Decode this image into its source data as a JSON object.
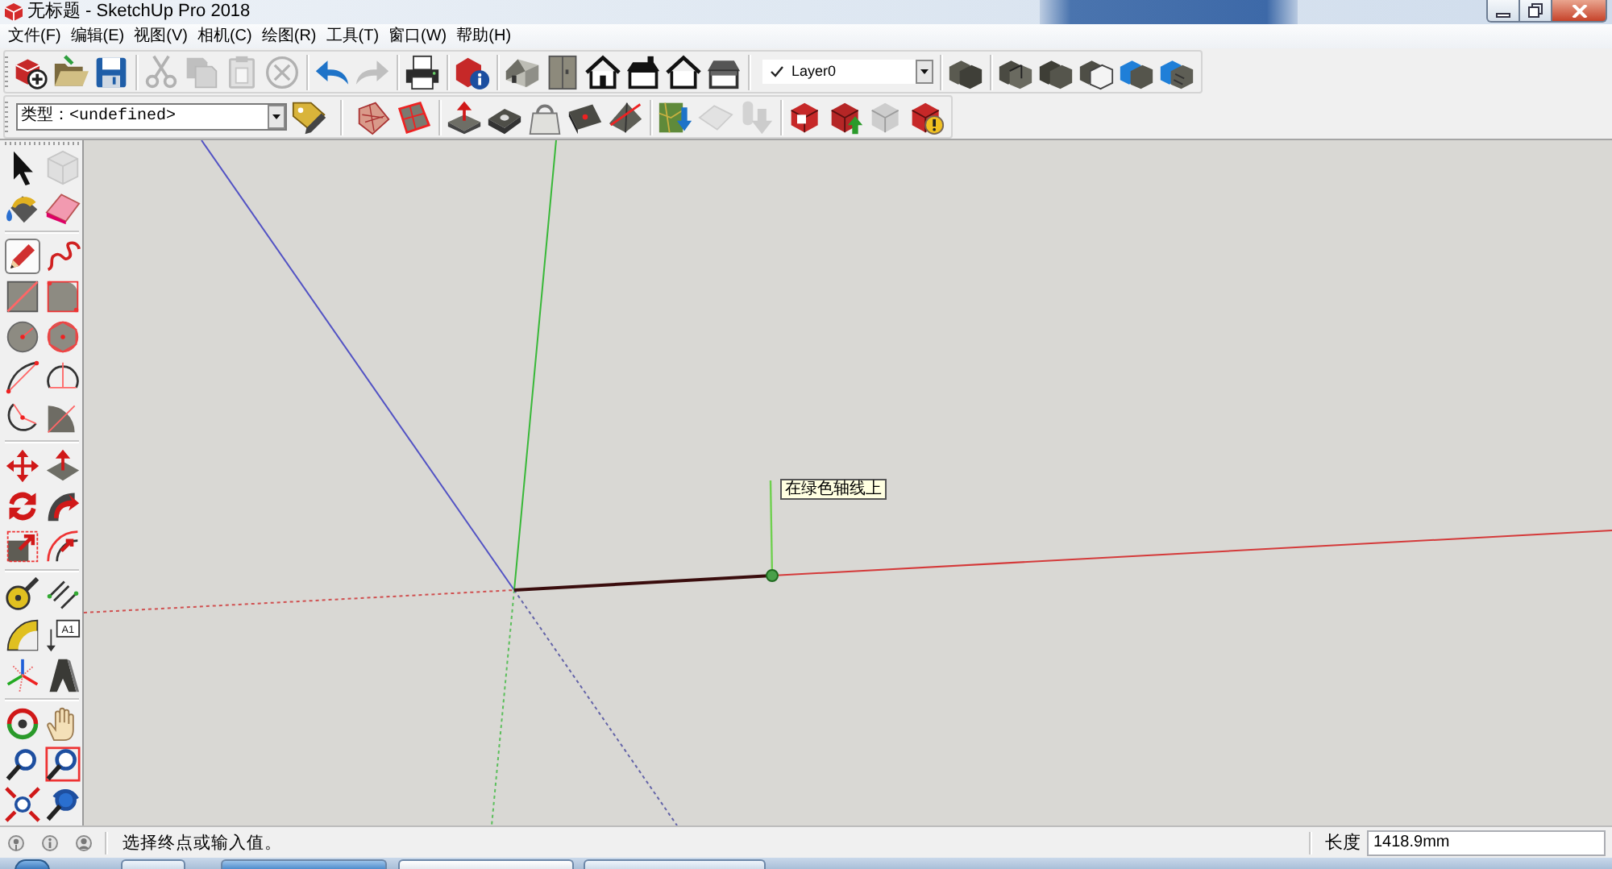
{
  "window": {
    "title": "无标题 - SketchUp Pro 2018"
  },
  "menu_bar": [
    "文件(F)",
    "编辑(E)",
    "视图(V)",
    "相机(C)",
    "绘图(R)",
    "工具(T)",
    "窗口(W)",
    "帮助(H)"
  ],
  "toolbar_row_1": [
    {
      "kind": "buttons",
      "items": [
        {
          "kind": "new",
          "disabled": false
        },
        {
          "kind": "open",
          "disabled": false
        },
        {
          "kind": "save",
          "disabled": false
        }
      ]
    },
    {
      "kind": "buttons",
      "items": [
        {
          "kind": "cut",
          "disabled": true
        },
        {
          "kind": "copy",
          "disabled": true
        },
        {
          "kind": "paste",
          "disabled": true
        },
        {
          "kind": "erase",
          "disabled": true
        }
      ]
    },
    {
      "kind": "buttons",
      "items": [
        {
          "kind": "undo",
          "disabled": false
        },
        {
          "kind": "redo",
          "disabled": true
        }
      ]
    },
    {
      "kind": "buttons",
      "items": [
        {
          "kind": "print",
          "disabled": false
        }
      ]
    },
    {
      "kind": "buttons",
      "items": [
        {
          "kind": "info",
          "disabled": false
        }
      ]
    },
    {
      "kind": "buttons",
      "items": [
        {
          "kind": "iso",
          "disabled": false
        },
        {
          "kind": "top",
          "disabled": false
        },
        {
          "kind": "front",
          "disabled": false
        },
        {
          "kind": "right",
          "disabled": false
        },
        {
          "kind": "back",
          "disabled": false
        },
        {
          "kind": "left",
          "disabled": false
        }
      ]
    },
    {
      "kind": "layer",
      "value": "Layer0"
    },
    {
      "kind": "buttons",
      "items": [
        {
          "kind": "xray",
          "disabled": false
        }
      ]
    },
    {
      "kind": "buttons",
      "items": [
        {
          "kind": "backedges",
          "disabled": false
        },
        {
          "kind": "wireframe",
          "disabled": false
        },
        {
          "kind": "hidden",
          "disabled": false
        },
        {
          "kind": "shaded",
          "disabled": false
        },
        {
          "kind": "textured",
          "disabled": false
        }
      ]
    }
  ],
  "toolbar_row_2": [
    {
      "kind": "type",
      "value": "类型：<undefined>",
      "items": [
        {
          "kind": "tagpen",
          "disabled": false
        }
      ]
    },
    {
      "kind": "buttons",
      "items": [
        {
          "kind": "tiles",
          "disabled": false
        },
        {
          "kind": "redgrid",
          "disabled": false
        }
      ]
    },
    {
      "kind": "buttons",
      "items": [
        {
          "kind": "boxarrow",
          "disabled": false
        },
        {
          "kind": "boxhole",
          "disabled": false
        },
        {
          "kind": "bag",
          "disabled": false
        },
        {
          "kind": "plate",
          "disabled": false
        },
        {
          "kind": "pyramid",
          "disabled": false
        }
      ]
    },
    {
      "kind": "buttons",
      "items": [
        {
          "kind": "map",
          "disabled": false
        },
        {
          "kind": "rhombus",
          "disabled": true
        },
        {
          "kind": "downarrow",
          "disabled": true
        }
      ]
    },
    {
      "kind": "buttons",
      "items": [
        {
          "kind": "redcube",
          "disabled": false
        },
        {
          "kind": "cubeup",
          "disabled": false
        },
        {
          "kind": "greycube",
          "disabled": true
        },
        {
          "kind": "cubewarn",
          "disabled": false
        }
      ]
    }
  ],
  "tool_palette": [
    {
      "items": [
        {
          "kind": "select",
          "selected": false,
          "disabled": false
        },
        {
          "kind": "component",
          "selected": false,
          "disabled": true
        },
        {
          "kind": "paint",
          "selected": false,
          "disabled": false
        },
        {
          "kind": "eraser",
          "selected": false,
          "disabled": false
        }
      ]
    },
    {
      "items": [
        {
          "kind": "pencil",
          "selected": true,
          "disabled": false
        },
        {
          "kind": "freehand",
          "selected": false,
          "disabled": false
        },
        {
          "kind": "rectangle",
          "selected": false,
          "disabled": false
        },
        {
          "kind": "rotrect",
          "selected": false,
          "disabled": false
        },
        {
          "kind": "circle",
          "selected": false,
          "disabled": false
        },
        {
          "kind": "polygon",
          "selected": false,
          "disabled": false
        },
        {
          "kind": "arc",
          "selected": false,
          "disabled": false
        },
        {
          "kind": "arc2",
          "selected": false,
          "disabled": false
        },
        {
          "kind": "arc3",
          "selected": false,
          "disabled": false
        },
        {
          "kind": "pie",
          "selected": false,
          "disabled": false
        }
      ]
    },
    {
      "items": [
        {
          "kind": "move",
          "selected": false,
          "disabled": false
        },
        {
          "kind": "pushpull",
          "selected": false,
          "disabled": false
        },
        {
          "kind": "rotate",
          "selected": false,
          "disabled": false
        },
        {
          "kind": "followme",
          "selected": false,
          "disabled": false
        },
        {
          "kind": "scale",
          "selected": false,
          "disabled": false
        },
        {
          "kind": "offset",
          "selected": false,
          "disabled": false
        }
      ]
    },
    {
      "items": [
        {
          "kind": "tape",
          "selected": false,
          "disabled": false
        },
        {
          "kind": "dimension",
          "selected": false,
          "disabled": false
        },
        {
          "kind": "protractor",
          "selected": false,
          "disabled": false
        },
        {
          "kind": "text",
          "selected": false,
          "disabled": false,
          "label": "A1"
        },
        {
          "kind": "axes",
          "selected": false,
          "disabled": false
        },
        {
          "kind": "text3d",
          "selected": false,
          "disabled": false
        }
      ]
    },
    {
      "items": [
        {
          "kind": "orbit",
          "selected": false,
          "disabled": false
        },
        {
          "kind": "pan",
          "selected": false,
          "disabled": false
        },
        {
          "kind": "zoom",
          "selected": false,
          "disabled": false
        },
        {
          "kind": "zoomwin",
          "selected": false,
          "disabled": false
        },
        {
          "kind": "zoomext",
          "selected": false,
          "disabled": false
        },
        {
          "kind": "previous",
          "selected": false,
          "disabled": false
        }
      ]
    }
  ],
  "canvas": {
    "tooltip": "在绿色轴线上"
  },
  "status_bar": {
    "message": "选择终点或输入值。",
    "measurement_label": "长度",
    "measurement_value": "1418.9mm"
  }
}
